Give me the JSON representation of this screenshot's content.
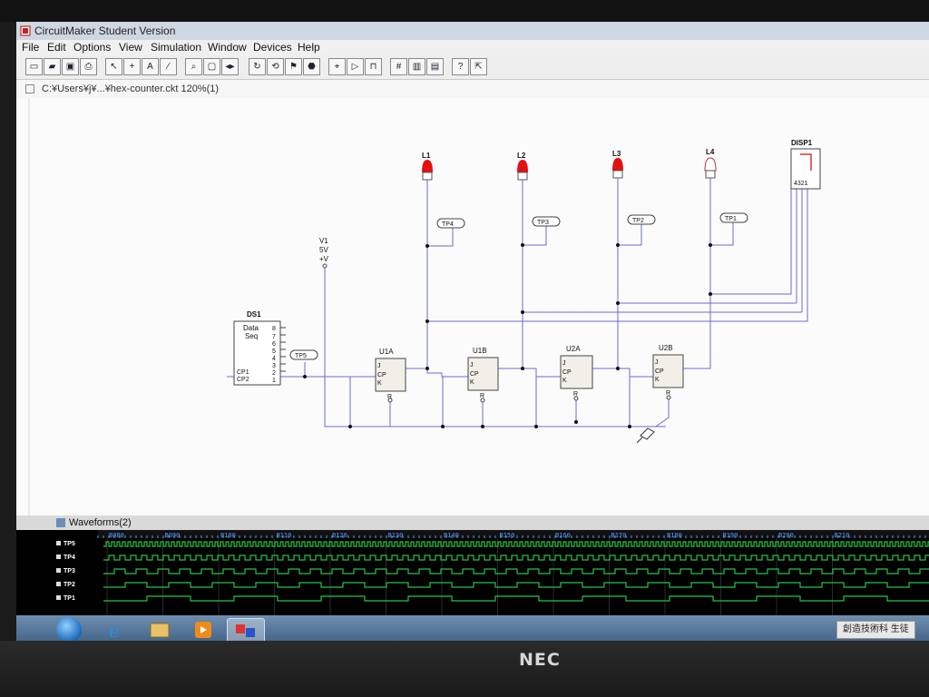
{
  "window": {
    "title": "CircuitMaker Student Version"
  },
  "menu": [
    "File",
    "Edit",
    "Options",
    "View",
    "Simulation",
    "Window",
    "Devices",
    "Help"
  ],
  "toolbar": [
    "new",
    "open",
    "save",
    "print",
    "select",
    "wire",
    "text",
    "probe",
    "zoom",
    "fit",
    "pan",
    "rotate",
    "flip",
    "run",
    "stop",
    "trace",
    "step",
    "waveform",
    "help",
    "info"
  ],
  "document": {
    "title": "C:¥Users¥j¥...¥hex-counter.ckt 120%(1)"
  },
  "schematic": {
    "lamps": [
      "L1",
      "L2",
      "L3",
      "L4"
    ],
    "display": {
      "name": "DISP1",
      "pins": "4321"
    },
    "testpoints": [
      "TP4",
      "TP3",
      "TP2",
      "TP1",
      "TP5"
    ],
    "source": {
      "name": "V1",
      "value": "5V",
      "pin": "+V"
    },
    "seq": {
      "name": "DS1",
      "l1": "Data",
      "l2": "Seq",
      "pins": [
        "8",
        "7",
        "6",
        "5",
        "4",
        "3",
        "2",
        "1"
      ],
      "cp1": "CP1",
      "cp2": "CP2"
    },
    "ffs": [
      "U1A",
      "U1B",
      "U2A",
      "U2B"
    ],
    "ffPins": {
      "j": "J",
      "cp": "CP",
      "k": "K",
      "r": "R"
    }
  },
  "waveforms": {
    "title": "Waveforms(2)",
    "channels": [
      "TP5",
      "TP4",
      "TP3",
      "TP2",
      "TP1"
    ],
    "ticks": [
      "B080",
      "B090",
      "B100",
      "B110",
      "B120",
      "B130",
      "B140",
      "B150",
      "B160",
      "B170",
      "B180",
      "B190",
      "B200",
      "B210"
    ]
  },
  "taskbar": {
    "ime": "創造技術科  生徒"
  }
}
